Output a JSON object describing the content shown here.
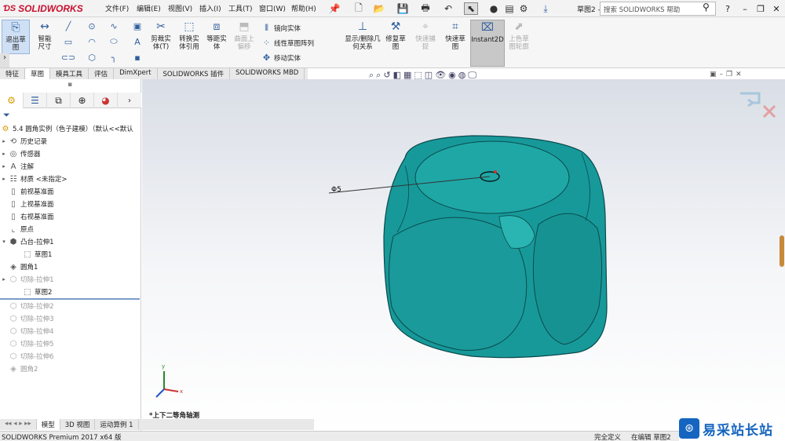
{
  "app": {
    "logo": "SOLIDWORKS",
    "title": "草图2 - 5...",
    "search_placeholder": "搜索 SOLIDWORKS 帮助",
    "help": "?"
  },
  "menu": [
    "文件(F)",
    "编辑(E)",
    "视图(V)",
    "插入(I)",
    "工具(T)",
    "窗口(W)",
    "帮助(H)"
  ],
  "ribbon": {
    "exit_sketch": "退出草图",
    "smart_dim": "智能尺寸",
    "trim": "剪裁实体(T)",
    "convert": "转换实体引用",
    "offset": "等距实体",
    "surface_offset": "曲面上偏移",
    "mirror": "镜向实体",
    "linear_pattern": "线性草图阵列",
    "move": "移动实体",
    "show_relations": "显示/删除几何关系",
    "repair": "修复草图",
    "quick_snaps": "快速捕捉",
    "rapid_sketch": "快速草图",
    "instant2d": "Instant2D",
    "shaded_sketch": "上色草图轮廓"
  },
  "tabs": [
    "特征",
    "草图",
    "模具工具",
    "评估",
    "DimXpert",
    "SOLIDWORKS 插件",
    "SOLIDWORKS MBD"
  ],
  "active_tab": "草图",
  "tree": {
    "root": "5.4 圆角实例（色子建模）（默认<<默认",
    "items": [
      {
        "label": "历史记录",
        "icon": "history-icon"
      },
      {
        "label": "传感器",
        "icon": "sensor-icon"
      },
      {
        "label": "注解",
        "icon": "annotation-icon"
      },
      {
        "label": "材质 <未指定>",
        "icon": "material-icon"
      },
      {
        "label": "前视基准面",
        "icon": "plane-icon"
      },
      {
        "label": "上视基准面",
        "icon": "plane-icon"
      },
      {
        "label": "右视基准面",
        "icon": "plane-icon"
      },
      {
        "label": "原点",
        "icon": "origin-icon"
      },
      {
        "label": "凸台-拉伸1",
        "icon": "extrude-icon"
      },
      {
        "label": "草图1",
        "icon": "sketch-icon"
      },
      {
        "label": "圆角1",
        "icon": "fillet-icon"
      },
      {
        "label": "切除-拉伸1",
        "icon": "cut-icon"
      },
      {
        "label": "草图2",
        "icon": "sketch-icon"
      },
      {
        "label": "切除-拉伸2",
        "icon": "cut-icon"
      },
      {
        "label": "切除-拉伸3",
        "icon": "cut-icon"
      },
      {
        "label": "切除-拉伸4",
        "icon": "cut-icon"
      },
      {
        "label": "切除-拉伸5",
        "icon": "cut-icon"
      },
      {
        "label": "切除-拉伸6",
        "icon": "cut-icon"
      },
      {
        "label": "圆角2",
        "icon": "fillet-icon"
      }
    ]
  },
  "viewport": {
    "dimension": "Φ5",
    "orientation": "*上下二等角轴测",
    "model_color": "#1a9c9c"
  },
  "bottom_tabs": [
    "模型",
    "3D 视图",
    "运动算例 1"
  ],
  "status": {
    "left": "SOLIDWORKS Premium 2017 x64 版",
    "define": "完全定义",
    "editing": "在编辑 草图2"
  },
  "watermark": "易采站长站"
}
